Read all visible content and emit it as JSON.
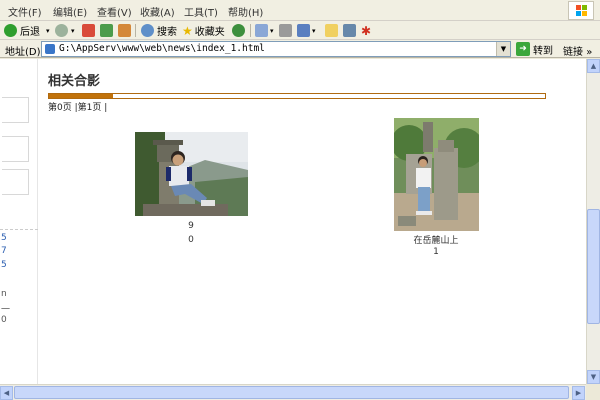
{
  "menu": {
    "items": [
      "文件(F)",
      "编辑(E)",
      "查看(V)",
      "收藏(A)",
      "工具(T)",
      "帮助(H)"
    ]
  },
  "toolbar": {
    "back_label": "后退",
    "search_label": "搜索",
    "favorites_label": "收藏夹"
  },
  "address": {
    "label": "地址(D)",
    "url": "G:\\AppServ\\www\\web\\news\\index_1.html",
    "go_label": "转到",
    "links_label": "链接"
  },
  "sidebar": {
    "chars": [
      "5",
      "7",
      "5",
      "n",
      "一",
      "0"
    ]
  },
  "page": {
    "title": "相关合影",
    "progress": 0.13,
    "pager_text": "第0页 |第1页 |"
  },
  "photos": [
    {
      "caption_line1": "9",
      "caption_line2": "0"
    },
    {
      "caption_line1": "在岳麓山上",
      "caption_line2": "1"
    }
  ],
  "colors": {
    "accent": "#c1720b",
    "chrome": "#f1efe2"
  }
}
